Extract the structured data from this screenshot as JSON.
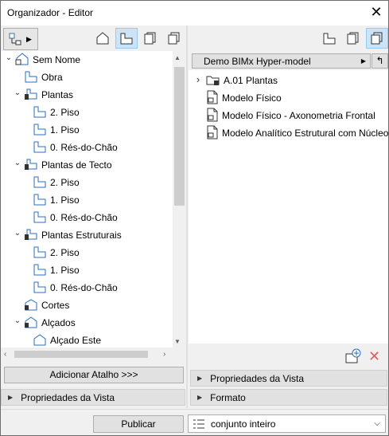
{
  "window": {
    "title": "Organizador - Editor",
    "close_glyph": "✕"
  },
  "left": {
    "view_buttons": [
      {
        "icon": "project-map-icon",
        "selected": false
      },
      {
        "icon": "view-map-icon",
        "selected": true
      },
      {
        "icon": "layout-book-icon",
        "selected": false
      },
      {
        "icon": "publisher-sets-icon",
        "selected": false
      }
    ],
    "tree": [
      {
        "label": "Sem Nome",
        "icon": "project-icon",
        "indent": 0,
        "expander": "down"
      },
      {
        "label": "Obra",
        "icon": "story-icon",
        "indent": 1,
        "expander": ""
      },
      {
        "label": "Plantas",
        "icon": "folder-view-icon",
        "indent": 1,
        "expander": "down"
      },
      {
        "label": "2. Piso",
        "icon": "story-icon",
        "indent": 2,
        "expander": ""
      },
      {
        "label": "1. Piso",
        "icon": "story-icon",
        "indent": 2,
        "expander": ""
      },
      {
        "label": "0. Rés-do-Chão",
        "icon": "story-icon",
        "indent": 2,
        "expander": ""
      },
      {
        "label": "Plantas de Tecto",
        "icon": "folder-view-icon",
        "indent": 1,
        "expander": "down"
      },
      {
        "label": "2. Piso",
        "icon": "story-icon",
        "indent": 2,
        "expander": ""
      },
      {
        "label": "1. Piso",
        "icon": "story-icon",
        "indent": 2,
        "expander": ""
      },
      {
        "label": "0. Rés-do-Chão",
        "icon": "story-icon",
        "indent": 2,
        "expander": ""
      },
      {
        "label": "Plantas Estruturais",
        "icon": "folder-view-icon",
        "indent": 1,
        "expander": "down"
      },
      {
        "label": "2. Piso",
        "icon": "story-icon",
        "indent": 2,
        "expander": ""
      },
      {
        "label": "1. Piso",
        "icon": "story-icon",
        "indent": 2,
        "expander": ""
      },
      {
        "label": "0. Rés-do-Chão",
        "icon": "story-icon",
        "indent": 2,
        "expander": ""
      },
      {
        "label": "Cortes",
        "icon": "section-icon",
        "indent": 1,
        "expander": ""
      },
      {
        "label": "Alçados",
        "icon": "elevation-icon",
        "indent": 1,
        "expander": "down"
      },
      {
        "label": "Alçado Este",
        "icon": "elevation-item-icon",
        "indent": 2,
        "expander": ""
      }
    ],
    "add_shortcut_label": "Adicionar Atalho >>>",
    "view_props_label": "Propriedades da Vista"
  },
  "right": {
    "model_header": "Demo BIMx Hyper-model",
    "items": [
      {
        "label": "A.01 Plantas",
        "icon": "folder-set-icon",
        "expander": "right"
      },
      {
        "label": "Modelo Físico",
        "icon": "document-icon",
        "expander": ""
      },
      {
        "label": "Modelo Físico - Axonometria Frontal",
        "icon": "document-icon",
        "expander": ""
      },
      {
        "label": "Modelo Analítico Estrutural com Núcleo",
        "icon": "document-icon",
        "expander": ""
      }
    ],
    "view_props_label": "Propriedades da Vista",
    "format_label": "Formato"
  },
  "footer": {
    "publish_label": "Publicar",
    "set_select_value": "conjunto inteiro"
  }
}
